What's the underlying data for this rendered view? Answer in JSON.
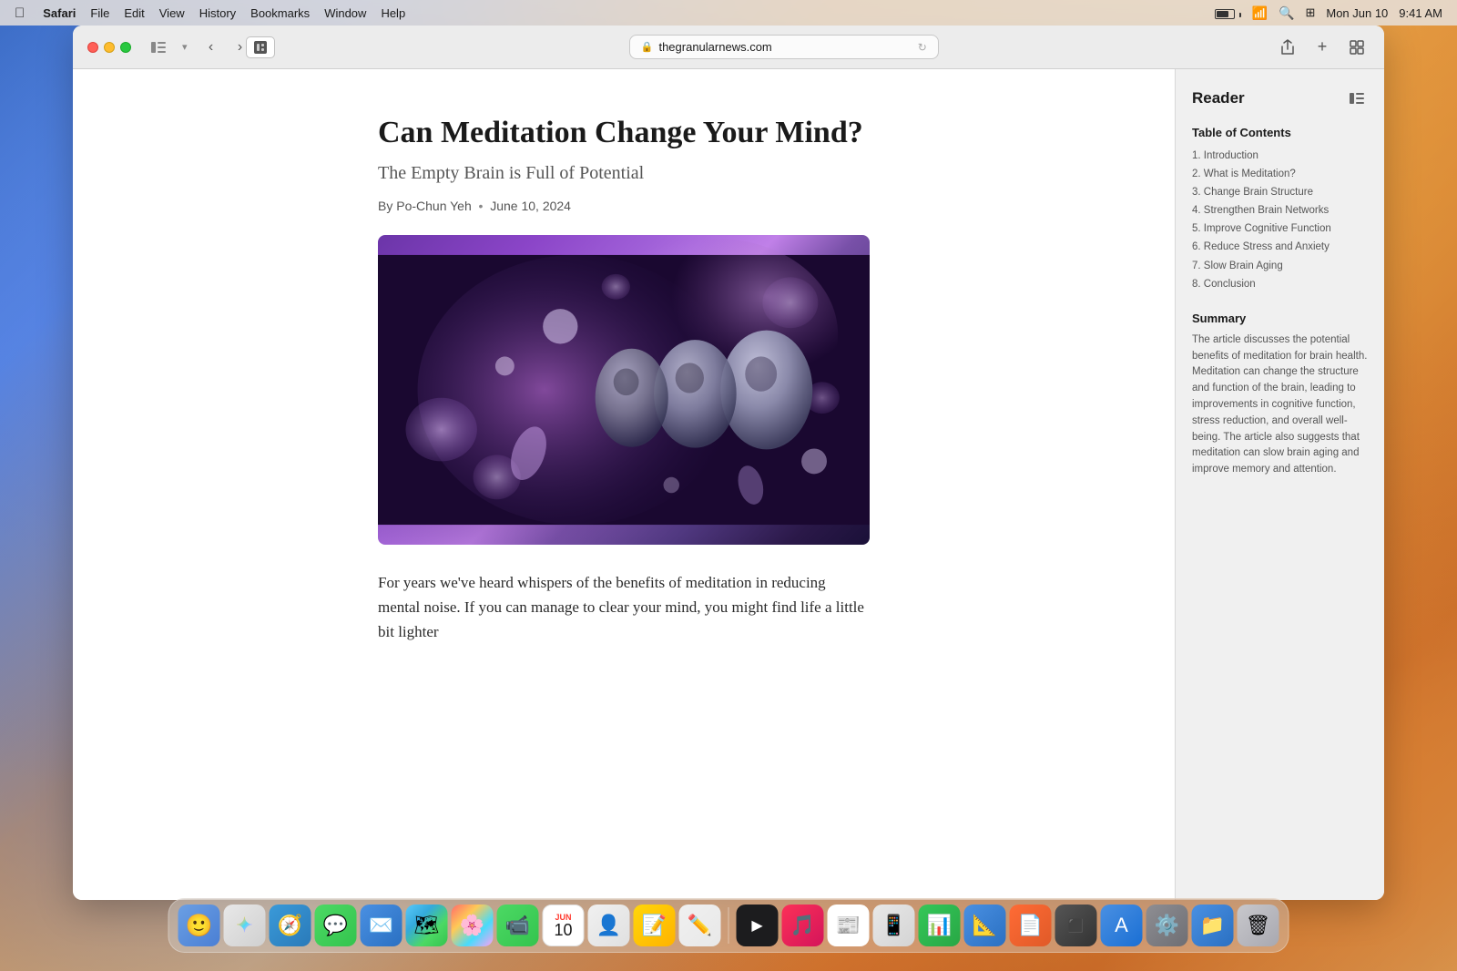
{
  "menubar": {
    "apple_label": "",
    "safari_label": "Safari",
    "file_label": "File",
    "edit_label": "Edit",
    "view_label": "View",
    "history_label": "History",
    "bookmarks_label": "Bookmarks",
    "window_label": "Window",
    "help_label": "Help",
    "date": "Mon Jun 10",
    "time": "9:41 AM"
  },
  "safari": {
    "url": "thegranularnews.com",
    "back_label": "‹",
    "forward_label": "›"
  },
  "article": {
    "title": "Can Meditation Change Your Mind?",
    "subtitle": "The Empty Brain is Full of Potential",
    "byline": "By Po-Chun Yeh",
    "date": "June 10, 2024",
    "body_text": "For years we've heard whispers of the benefits of meditation in reducing mental noise. If you can manage to clear your mind, you might find life a little bit lighter"
  },
  "reader": {
    "title": "Reader",
    "toc_label": "Table of Contents",
    "toc_items": [
      "1. Introduction",
      "2. What is Meditation?",
      "3. Change Brain Structure",
      "4. Strengthen Brain Networks",
      "5. Improve Cognitive Function",
      "6. Reduce Stress and Anxiety",
      "7. Slow Brain Aging",
      "8. Conclusion"
    ],
    "summary_label": "Summary",
    "summary_text": "The article discusses the potential benefits of meditation for brain health. Meditation can change the structure and function of the brain, leading to improvements in cognitive function, stress reduction, and overall well-being. The article also suggests that meditation can slow brain aging and improve memory and attention."
  },
  "dock": {
    "items": [
      {
        "name": "Finder",
        "emoji": "🔵",
        "class": "dock-finder"
      },
      {
        "name": "Launchpad",
        "emoji": "🚀",
        "class": "dock-launchpad"
      },
      {
        "name": "Safari",
        "emoji": "🧭",
        "class": "dock-safari"
      },
      {
        "name": "Messages",
        "emoji": "💬",
        "class": "dock-messages"
      },
      {
        "name": "Mail",
        "emoji": "✉️",
        "class": "dock-mail"
      },
      {
        "name": "Maps",
        "emoji": "🗺",
        "class": "dock-maps"
      },
      {
        "name": "Photos",
        "emoji": "🌸",
        "class": "dock-photos"
      },
      {
        "name": "FaceTime",
        "emoji": "📹",
        "class": "dock-facetime"
      },
      {
        "name": "Calendar",
        "emoji": "10",
        "class": "dock-calendar"
      },
      {
        "name": "Contacts",
        "emoji": "👤",
        "class": "dock-contacts"
      },
      {
        "name": "Notes",
        "emoji": "📝",
        "class": "dock-notes"
      },
      {
        "name": "Freeform",
        "emoji": "✏️",
        "class": "dock-freeform"
      },
      {
        "name": "AppleTV",
        "emoji": "📺",
        "class": "dock-appletv"
      },
      {
        "name": "Music",
        "emoji": "🎵",
        "class": "dock-music"
      },
      {
        "name": "News",
        "emoji": "📰",
        "class": "dock-news"
      },
      {
        "name": "iPhone Mirror",
        "emoji": "📱",
        "class": "dock-iphone"
      },
      {
        "name": "Numbers",
        "emoji": "📊",
        "class": "dock-numbers"
      },
      {
        "name": "Keynote",
        "emoji": "📐",
        "class": "dock-keynote"
      },
      {
        "name": "Pages",
        "emoji": "📄",
        "class": "dock-pages"
      },
      {
        "name": "Simulator",
        "emoji": "⬛",
        "class": "dock-simulator"
      },
      {
        "name": "App Store",
        "emoji": "🅰",
        "class": "dock-appstore"
      },
      {
        "name": "System Preferences",
        "emoji": "⚙️",
        "class": "dock-preferences"
      },
      {
        "name": "Files",
        "emoji": "📁",
        "class": "dock-files"
      },
      {
        "name": "Trash",
        "emoji": "🗑",
        "class": "dock-trash"
      }
    ]
  }
}
